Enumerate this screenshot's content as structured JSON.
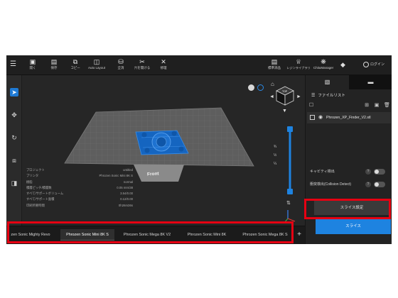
{
  "toolbar": {
    "items": [
      {
        "icon": "folder-open-icon",
        "label": "開く"
      },
      {
        "icon": "save-icon",
        "label": "保存"
      },
      {
        "icon": "copy-icon",
        "label": "コピー"
      },
      {
        "icon": "auto-layout-icon",
        "label": "Auto Layout"
      },
      {
        "icon": "database-icon",
        "label": "全消"
      },
      {
        "icon": "cut-icon",
        "label": "穴を開ける"
      },
      {
        "icon": "tools-icon",
        "label": "修理"
      }
    ],
    "right_items": [
      {
        "icon": "save-icon",
        "label": "標準添品"
      },
      {
        "icon": "library-icon",
        "label": "レジンライブラリ"
      },
      {
        "icon": "chitu-icon",
        "label": "ChituManager"
      }
    ],
    "login_label": "ログイン"
  },
  "viewport": {
    "bed_label": "Front",
    "zoom_labels": [
      "¾",
      "½",
      "¼"
    ],
    "project_info": [
      {
        "key": "プロジェクト",
        "value": "untitled"
      },
      {
        "key": "プリンタ",
        "value": "Phrozen Sonic Mini 8K S"
      },
      {
        "key": "樹脂",
        "value": "normal"
      },
      {
        "key": "積層ピッチ/積層数",
        "value": "0.05 mm/38"
      },
      {
        "key": "すべて/サポートボリューム",
        "value": "3.54/0.00"
      },
      {
        "key": "すべて/サポート面積",
        "value": "0.12/0.00"
      },
      {
        "key": "印刷所要時間",
        "value": "0h26m36s"
      }
    ]
  },
  "printer_tabs": [
    {
      "label": "zen Sonic Mighty Revo",
      "active": false
    },
    {
      "label": "Phrozen Sonic Mini 8K S",
      "active": true
    },
    {
      "label": "Phrozen Sonic Mega 8K V2",
      "active": false
    },
    {
      "label": "Phrozen Sonic Mini 8K",
      "active": false
    },
    {
      "label": "Phrozen Sonic Mega 8K S",
      "active": false
    }
  ],
  "right_panel": {
    "file_list_title": "ファイルリスト",
    "file_name": "Phrozen_XP_Finder_V2.stl",
    "options": [
      "キャビティ検出",
      "衝突検出(Collision Detect)"
    ],
    "slice_settings_label": "スライス設定",
    "slice_label": "スライス"
  },
  "colors": {
    "accent": "#1e83e0",
    "highlight_frame": "#e60012",
    "model": "#1565c0"
  }
}
